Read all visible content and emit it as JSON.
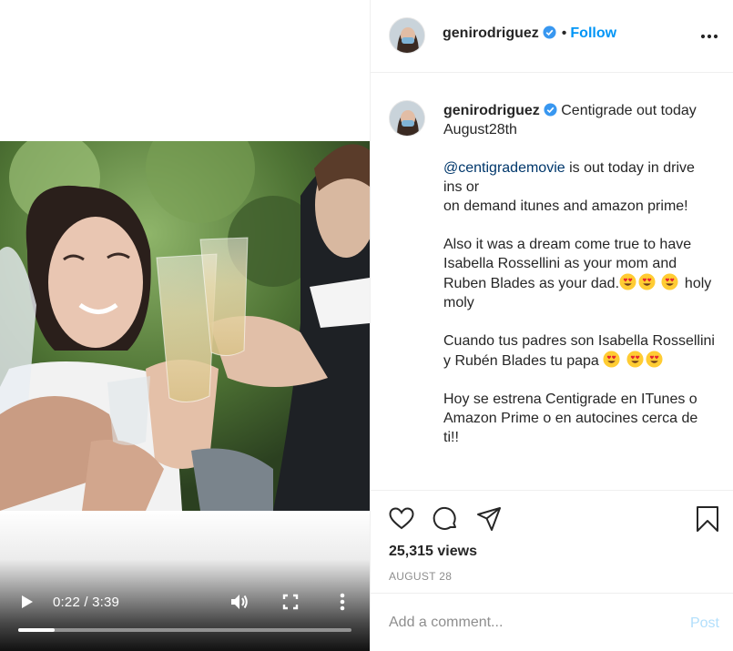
{
  "video": {
    "current_time": "0:22",
    "duration": "3:39",
    "time_display": "0:22 / 3:39",
    "progress_fraction": 0.11,
    "play_icon": "play-icon",
    "volume_icon": "volume-icon",
    "fullscreen_icon": "fullscreen-icon",
    "more_icon": "more-vertical-icon"
  },
  "header": {
    "username": "genirodriguez",
    "verified": true,
    "dot": "•",
    "follow_label": "Follow",
    "options_icon": "more-horizontal-icon"
  },
  "caption": {
    "username": "genirodriguez",
    "first_line": "Centigrade out today August28th",
    "mention": "@centigrademovie",
    "para1_rest": " is out today in drive ins or",
    "para1_line2": "on demand itunes and amazon prime!",
    "para2": "Also it was a dream come true to have Isabella Rossellini as your mom and Ruben Blades as your dad.",
    "para2_tail": "holy moly",
    "para3": "Cuando tus padres son Isabella Rossellini y Rubén Blades tu papa",
    "para4": "Hoy se estrena Centigrade en ITunes o Amazon Prime o en autocines cerca de ti!!",
    "emoji": "heart-eyes-emoji"
  },
  "actions": {
    "like_icon": "heart-icon",
    "comment_icon": "comment-icon",
    "share_icon": "share-icon",
    "save_icon": "bookmark-icon",
    "views": "25,315 views",
    "date": "AUGUST 28"
  },
  "comment_box": {
    "placeholder": "Add a comment...",
    "post_label": "Post"
  },
  "colors": {
    "accent": "#0095f6",
    "post_disabled": "#b2dffc",
    "mention": "#00376b",
    "muted": "#8e8e8e"
  }
}
